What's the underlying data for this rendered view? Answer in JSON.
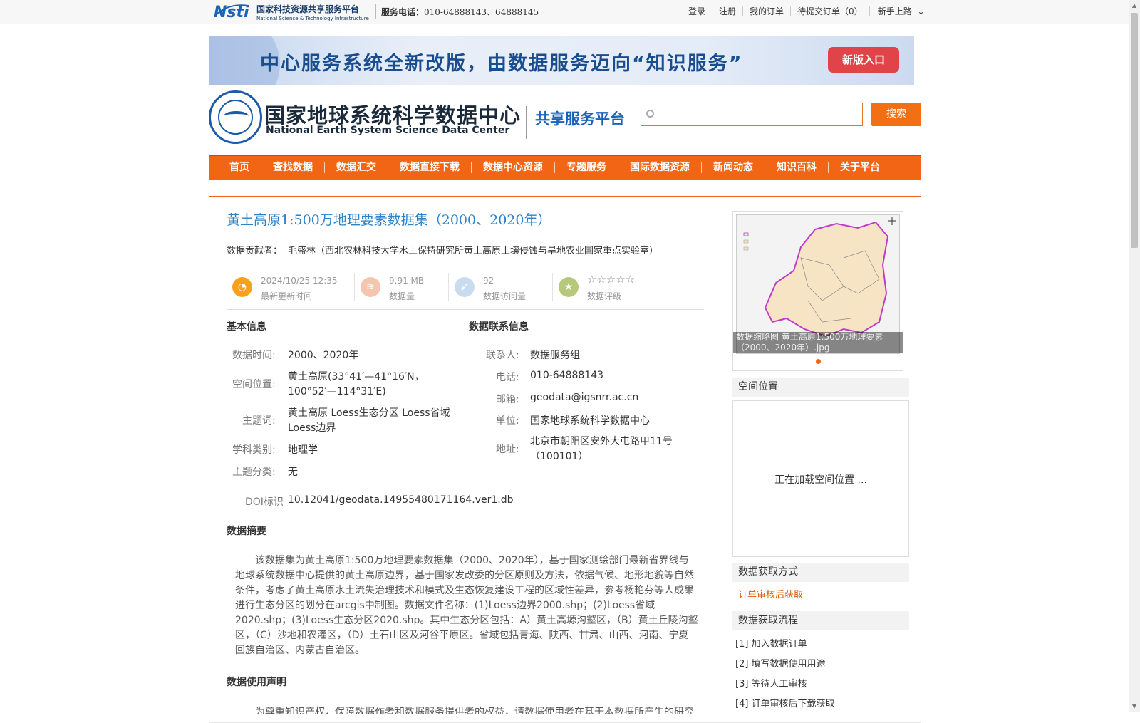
{
  "topbar": {
    "logo_text": "国家科技资源共享服务平台",
    "logo_sub": "National Science & Technology Infrastructure",
    "phone_label": "服务电话：",
    "phone_value": "010-64888143、64888145",
    "links": [
      "登录",
      "注册",
      "我的订单",
      "待提交订单（0）"
    ],
    "guide": "新手上路"
  },
  "banner": {
    "title": "中心服务系统全新改版，由数据服务迈向“知识服务”",
    "button": "新版入口"
  },
  "header": {
    "cname": "国家地球系统科学数据中心",
    "ename": "National Earth System Science Data Center",
    "platform": "共享服务平台",
    "search_placeholder": "",
    "search_button": "搜索"
  },
  "nav": [
    "首页",
    "查找数据",
    "数据汇交",
    "数据直接下载",
    "数据中心资源",
    "专题服务",
    "国际数据资源",
    "新闻动态",
    "知识百科",
    "关于平台"
  ],
  "dataset": {
    "title": "黄土高原1:500万地理要素数据集（2000、2020年）",
    "contributor_label": "数据贡献者：",
    "contributor": "毛盛林（西北农林科技大学水土保持研究所黄土高原土壤侵蚀与旱地农业国家重点实验室）",
    "stats": [
      {
        "value": "2024/10/25 12:35",
        "label": "最新更新时间",
        "icon": "clock-icon",
        "color": "#f7a21b"
      },
      {
        "value": "9.91 MB",
        "label": "数据量",
        "icon": "layers-icon",
        "color": "#f5c6ad"
      },
      {
        "value": "92",
        "label": "数据访问量",
        "icon": "cursor-icon",
        "color": "#c9dcef"
      },
      {
        "value": "☆☆☆☆☆",
        "label": "数据评级",
        "icon": "star-badge-icon",
        "color": "#b6c97a"
      }
    ],
    "basic_title": "基本信息",
    "contact_title": "数据联系信息",
    "basic": {
      "time_k": "数据时间:",
      "time_v": "2000、2020年",
      "space_k": "空间位置:",
      "space_v": "黄土高原(33°41′—41°16′N，100°52′—114°31′E)",
      "kw_k": "主题词:",
      "kw_v": "黄土高原   Loess生态分区   Loess省域   Loess边界",
      "subject_k": "学科类别:",
      "subject_v": "地理学",
      "topic_k": "主题分类:",
      "topic_v": "无",
      "doi_k": "DOI标识",
      "doi_v": "10.12041/geodata.14955480171164.ver1.db"
    },
    "contact": {
      "person_k": "联系人:",
      "person_v": "数据服务组",
      "phone_k": "电话:",
      "phone_v": "010-64888143",
      "mail_k": "邮箱:",
      "mail_v": "geodata@igsnrr.ac.cn",
      "unit_k": "单位:",
      "unit_v": "国家地球系统科学数据中心",
      "addr_k": "地址:",
      "addr_v": "北京市朝阳区安外大屯路甲11号（100101）"
    },
    "abstract_title": "数据摘要",
    "abstract": "该数据集为黄土高原1:500万地理要素数据集（2000、2020年），基于国家测绘部门最新省界线与地球系统数据中心提供的黄土高原边界，基于国家发改委的分区原则及方法，依据气候、地形地貌等自然条件，考虑了黄土高原水土流失治理技术和模式及生态恢复建设工程的区域性差异，参考杨艳芬等人成果进行生态分区的划分在arcgis中制图。数据文件名称：(1)Loess边界2000.shp；(2)Loess省域2020.shp；(3)Loess生态分区2020.shp。其中生态分区包括：A）黄土高塬沟壑区，（B）黄土丘陵沟壑区，（C）沙地和农灌区，（D）土石山区及河谷平原区。省域包括青海、陕西、甘肃、山西、河南、宁夏回族自治区、内蒙古自治区。",
    "usage_title": "数据使用声明",
    "usage": "为尊重知识产权，保障数据作者和数据服务提供者的权益，请数据使用者在基于本数据所产生的研究"
  },
  "side": {
    "thumb_caption": "数据缩略图  黄土高原1:500万地理要素（2000、2020年）.jpg",
    "spatial_title": "空间位置",
    "spatial_loading": "正在加载空间位置 ...",
    "access_title": "数据获取方式",
    "access_value": "订单审核后获取",
    "flow_title": "数据获取流程",
    "flow": [
      "[1] 加入数据订单",
      "[2] 填写数据使用用途",
      "[3] 等待人工审核",
      "[4] 订单审核后下载获取"
    ]
  }
}
